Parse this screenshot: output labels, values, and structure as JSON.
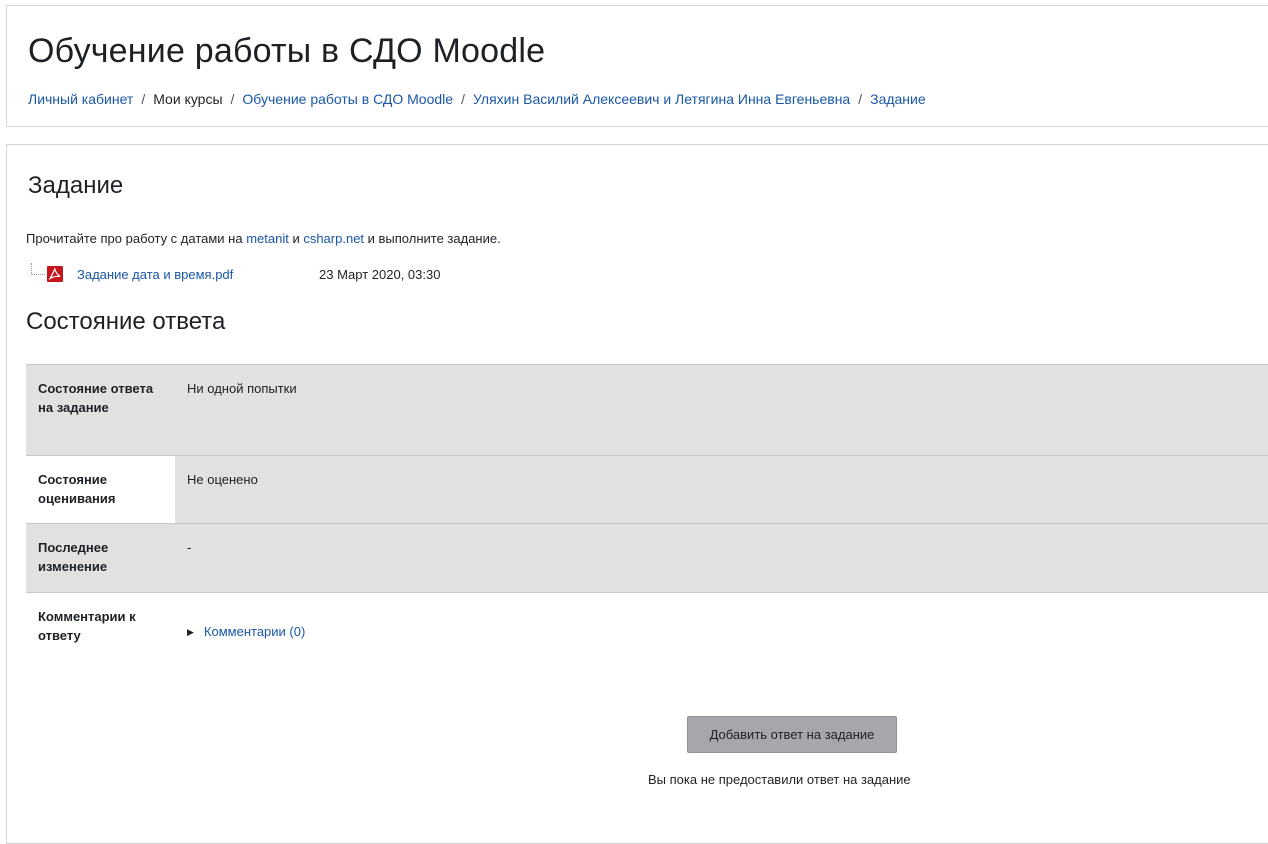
{
  "header": {
    "title": "Обучение работы в СДО Moodle",
    "breadcrumb": {
      "items": [
        {
          "label": "Личный кабинет",
          "link": true
        },
        {
          "label": "Мои курсы",
          "link": false
        },
        {
          "label": "Обучение работы в СДО Moodle",
          "link": true
        },
        {
          "label": "Уляхин Василий Алексеевич и Летягина Инна Евгеньевна",
          "link": true
        },
        {
          "label": "Задание",
          "link": true
        }
      ],
      "separator": "/"
    }
  },
  "assignment": {
    "title": "Задание",
    "intro": {
      "prefix": "Прочитайте про работу с датами на ",
      "link1": "metanit",
      "middle": " и ",
      "link2": "csharp.net",
      "suffix": " и выполните задание."
    },
    "file": {
      "name": "Задание дата и время.pdf",
      "date": "23 Март 2020, 03:30",
      "icon": "pdf-icon"
    }
  },
  "submission_status": {
    "title": "Состояние ответа",
    "rows": [
      {
        "label": "Состояние ответа на задание",
        "value": "Ни одной попытки"
      },
      {
        "label": "Состояние оценивания",
        "value": "Не оценено"
      },
      {
        "label": "Последнее изменение",
        "value": "-"
      },
      {
        "label": "Комментарии к ответу",
        "value": "Комментарии (0)"
      }
    ]
  },
  "actions": {
    "add_submission": "Добавить ответ на задание",
    "note": "Вы пока не предоставили ответ на задание"
  },
  "colors": {
    "link": "#1a57a8",
    "row_gray": "#e1e1e1",
    "button": "#a5a7aa",
    "pdf_red": "#c6141b"
  }
}
